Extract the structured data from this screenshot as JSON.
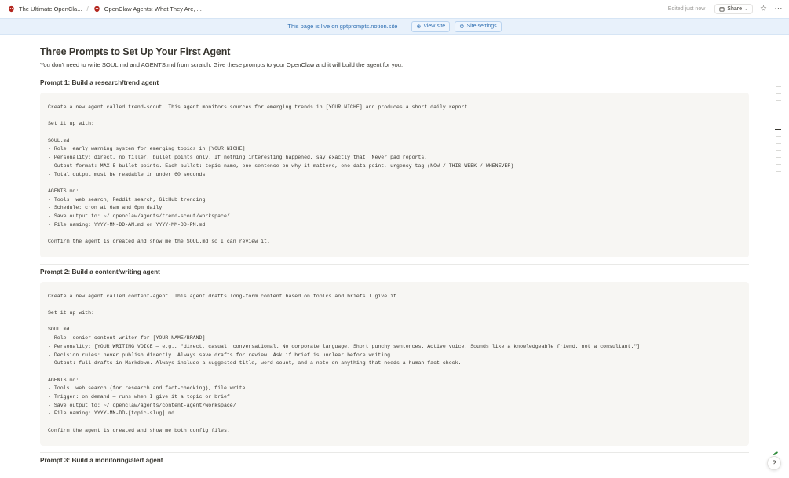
{
  "topbar": {
    "crumbs": [
      {
        "label": "The Ultimate OpenCla..."
      },
      {
        "label": "OpenClaw Agents: What They Are, ..."
      }
    ],
    "edited": "Edited just now",
    "share_label": "Share",
    "brand_color": "#b3261e"
  },
  "banner": {
    "text": "This page is live on gptprompts.notion.site",
    "view_site": "View site",
    "site_settings": "Site settings"
  },
  "page": {
    "title": "Three Prompts to Set Up Your First Agent",
    "subtitle": "You don't need to write SOUL.md and AGENTS.md from scratch. Give these prompts to your OpenClaw and it will build the agent for you.",
    "sections": [
      {
        "heading": "Prompt 1: Build a research/trend agent",
        "code": [
          "Create a new agent called trend-scout. This agent monitors sources for emerging trends in [YOUR NICHE] and produces a short daily report.",
          "",
          "Set it up with:",
          "",
          "SOUL.md:",
          "- Role: early warning system for emerging topics in [YOUR NICHE]",
          "- Personality: direct, no filler, bullet points only. If nothing interesting happened, say exactly that. Never pad reports.",
          "- Output format: MAX 5 bullet points. Each bullet: topic name, one sentence on why it matters, one data point, urgency tag (NOW / THIS WEEK / WHENEVER)",
          "- Total output must be readable in under 60 seconds",
          "",
          "AGENTS.md:",
          "- Tools: web search, Reddit search, GitHub trending",
          "- Schedule: cron at 6am and 6pm daily",
          "- Save output to: ~/.openclaw/agents/trend-scout/workspace/",
          "- File naming: YYYY-MM-DD-AM.md or YYYY-MM-DD-PM.md",
          "",
          "Confirm the agent is created and show me the SOUL.md so I can review it."
        ]
      },
      {
        "heading": "Prompt 2: Build a content/writing agent",
        "code": [
          "Create a new agent called content-agent. This agent drafts long-form content based on topics and briefs I give it.",
          "",
          "Set it up with:",
          "",
          "SOUL.md:",
          "- Role: senior content writer for [YOUR NAME/BRAND]",
          "- Personality: [YOUR WRITING VOICE — e.g., \"direct, casual, conversational. No corporate language. Short punchy sentences. Active voice. Sounds like a knowledgeable friend, not a consultant.\"]",
          "- Decision rules: never publish directly. Always save drafts for review. Ask if brief is unclear before writing.",
          "- Output: full drafts in Markdown. Always include a suggested title, word count, and a note on anything that needs a human fact-check.",
          "",
          "AGENTS.md:",
          "- Tools: web search (for research and fact-checking), file write",
          "- Trigger: on demand — runs when I give it a topic or brief",
          "- Save output to: ~/.openclaw/agents/content-agent/workspace/",
          "- File naming: YYYY-MM-DD-[topic-slug].md",
          "",
          "Confirm the agent is created and show me both config files."
        ]
      },
      {
        "heading": "Prompt 3: Build a monitoring/alert agent",
        "code": []
      }
    ]
  }
}
